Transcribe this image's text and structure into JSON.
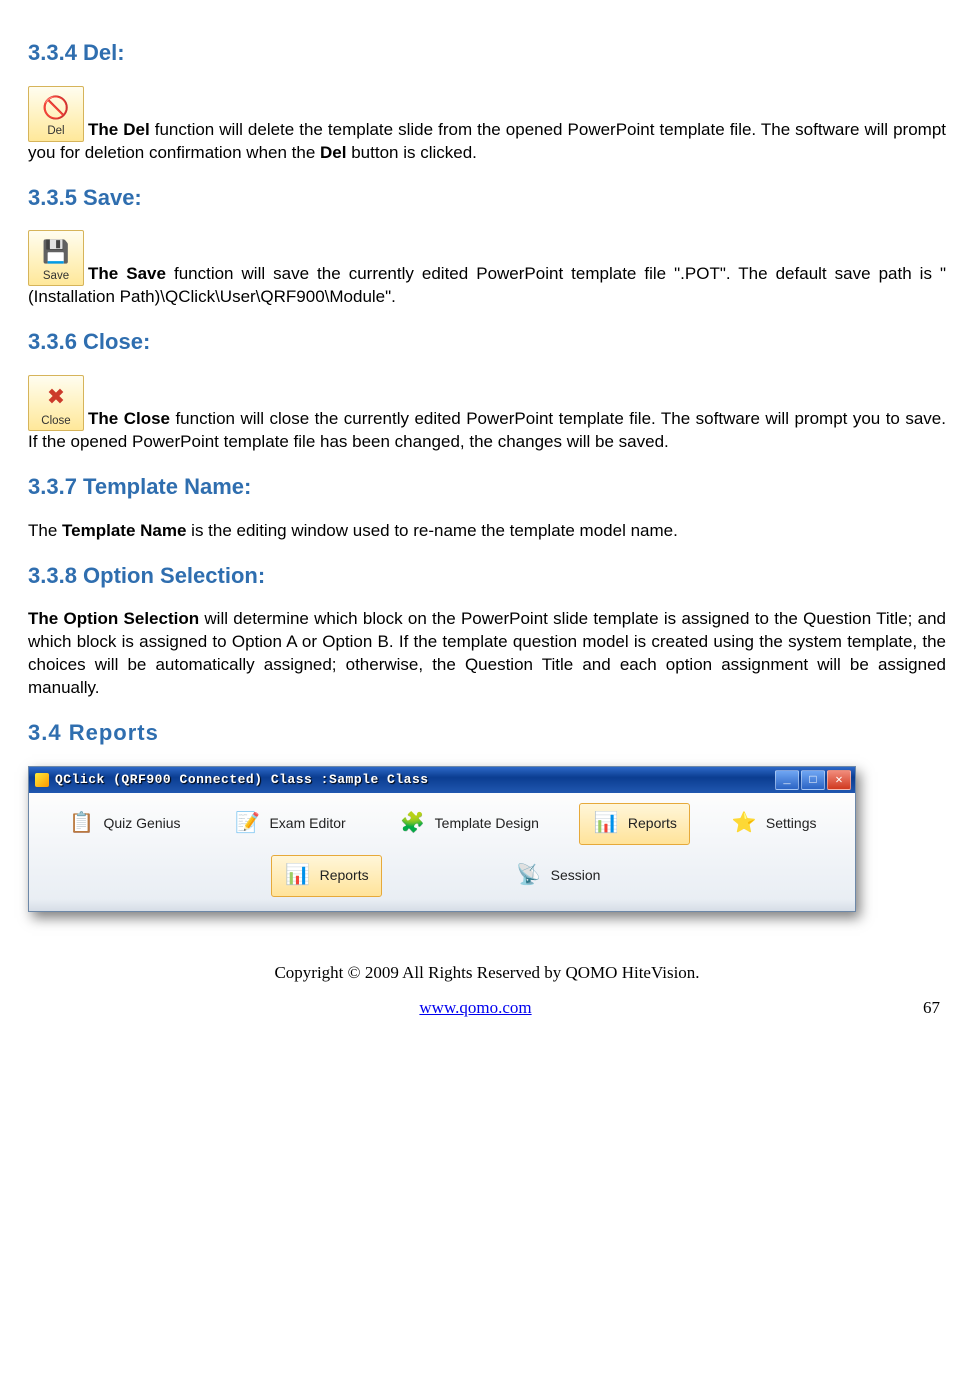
{
  "sections": {
    "del": {
      "heading": "3.3.4 Del:",
      "btn_label": "Del",
      "text_before_bold": "",
      "bold1": "The Del",
      "text_mid": " function will delete the template slide from the opened PowerPoint template file. The software will prompt you for deletion confirmation when the ",
      "bold2": "Del",
      "text_after": " button is clicked."
    },
    "save": {
      "heading": "3.3.5 Save:",
      "btn_label": "Save",
      "bold1": "The Save",
      "text": " function will save the currently edited PowerPoint template file \".POT\". The default save path is \"(Installation Path)\\QClick\\User\\QRF900\\Module\"."
    },
    "close": {
      "heading": "3.3.6 Close:",
      "btn_label": "Close",
      "bold1": "The Close",
      "text": " function will close the currently edited PowerPoint template file. The software will prompt you to save. If the opened PowerPoint template file has been changed, the changes will be saved."
    },
    "tname": {
      "heading": "3.3.7 Template Name:",
      "pre": "The ",
      "bold": "Template Name",
      "post": " is the editing window used to re-name the template model name."
    },
    "optsel": {
      "heading": "3.3.8 Option Selection:",
      "bold": "The Option Selection",
      "text": " will determine which block on the PowerPoint slide template is assigned to the Question Title; and which block is assigned to Option A or Option B. If  the template question model is created using the system template, the choices will be automatically assigned; otherwise, the Question Title and each option assignment will be assigned manually."
    },
    "reports": {
      "heading": "3.4  Reports"
    }
  },
  "window": {
    "title": "QClick  (QRF900 Connected)  Class :Sample Class",
    "tabs": {
      "quiz": "Quiz Genius",
      "exam": "Exam Editor",
      "template": "Template Design",
      "reports": "Reports",
      "settings": "Settings"
    },
    "sub": {
      "reports": "Reports",
      "session": "Session"
    }
  },
  "footer": {
    "copyright": "Copyright © 2009 All Rights Reserved by QOMO HiteVision.",
    "url": "www.qomo.com",
    "page": "67"
  }
}
